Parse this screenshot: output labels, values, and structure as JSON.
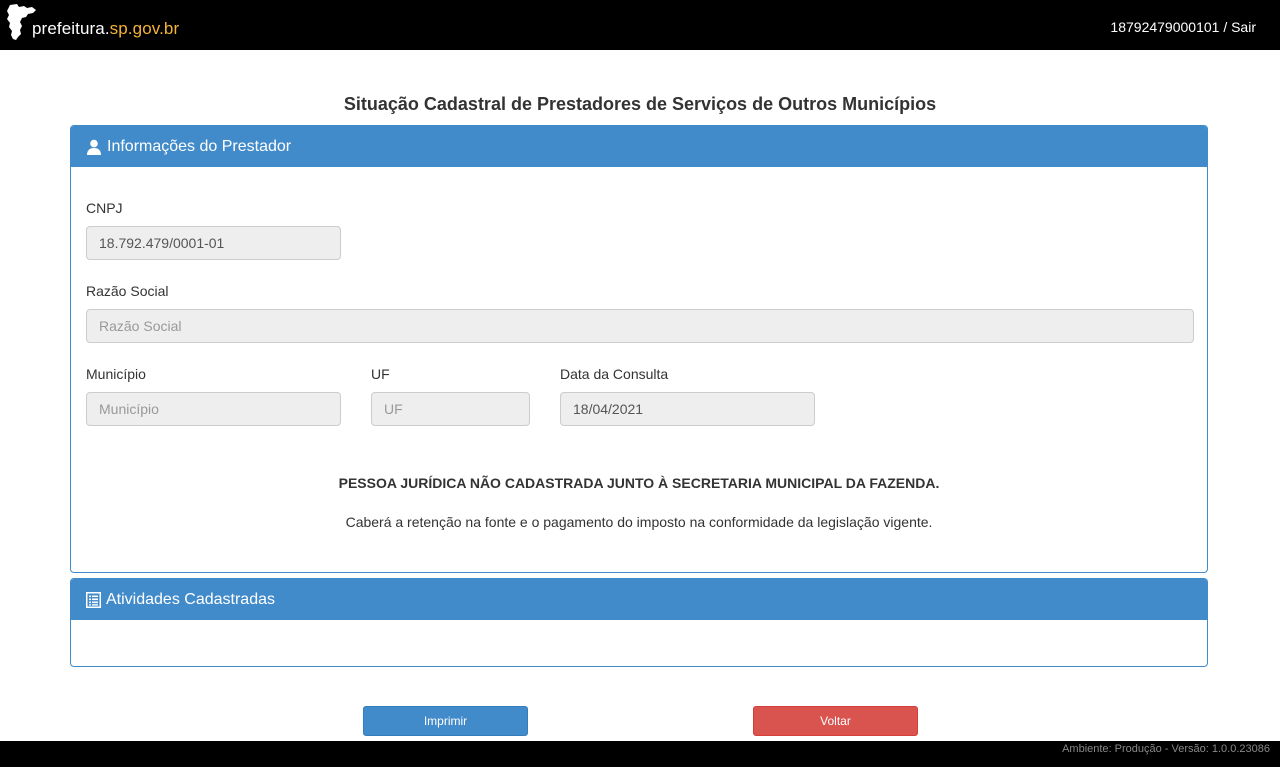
{
  "header": {
    "logo_text_main": "prefeitura.",
    "logo_text_accent": "sp.gov.br",
    "user_info": "18792479000101 / Sair"
  },
  "page": {
    "title": "Situação Cadastral de Prestadores de Serviços de Outros Municípios"
  },
  "panel_prestador": {
    "title": "Informações do Prestador",
    "icon": "user-icon",
    "cnpj_label": "CNPJ",
    "cnpj_value": "18.792.479/0001-01",
    "razao_label": "Razão Social",
    "razao_placeholder": "Razão Social",
    "municipio_label": "Município",
    "municipio_placeholder": "Município",
    "uf_label": "UF",
    "uf_placeholder": "UF",
    "data_label": "Data da Consulta",
    "data_value": "18/04/2021",
    "notice_title": "PESSOA JURÍDICA NÃO CADASTRADA JUNTO À SECRETARIA MUNICIPAL DA FAZENDA.",
    "notice_text": "Caberá a retenção na fonte e o pagamento do imposto na conformidade da legislação vigente."
  },
  "panel_atividades": {
    "title": "Atividades Cadastradas",
    "icon": "list-icon"
  },
  "buttons": {
    "print_label": "Imprimir",
    "back_label": "Voltar"
  },
  "footer": {
    "text": "Ambiente: Produção - Versão: 1.0.0.23086"
  },
  "colors": {
    "primary": "#428bca",
    "danger": "#d9534f",
    "accent": "#f5b335",
    "topbar": "#000000"
  }
}
